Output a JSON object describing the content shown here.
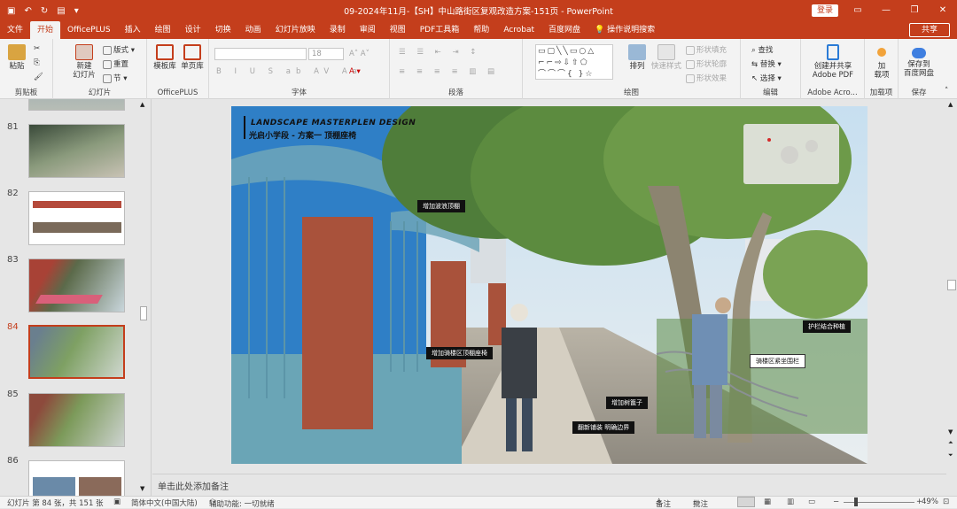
{
  "window": {
    "title": "09-2024年11月-【SH】中山路街区复观改造方案-151页 - PowerPoint",
    "login": "登录"
  },
  "tabs": [
    "文件",
    "开始",
    "OfficePLUS",
    "插入",
    "绘图",
    "设计",
    "切换",
    "动画",
    "幻灯片放映",
    "录制",
    "审阅",
    "视图",
    "PDF工具箱",
    "帮助",
    "Acrobat",
    "百度网盘"
  ],
  "active_tab": "开始",
  "tell_me": "操作说明搜索",
  "share": "共享",
  "ribbon": {
    "clipboard": {
      "paste": "粘贴",
      "label": "剪贴板"
    },
    "slides": {
      "new": "新建\n幻灯片",
      "layout": "版式",
      "reset": "重置",
      "section": "节",
      "label": "幻灯片"
    },
    "officeplus": {
      "templates": "模板库",
      "single": "单页库",
      "label": "OfficePLUS"
    },
    "font": {
      "size": "18",
      "label": "字体"
    },
    "paragraph": {
      "label": "段落"
    },
    "drawing": {
      "arrange": "排列",
      "quick_styles": "快速样式",
      "fill": "形状填充",
      "outline": "形状轮廓",
      "effects": "形状效果",
      "label": "绘图"
    },
    "editing": {
      "find": "查找",
      "replace": "替换",
      "select": "选择",
      "label": "编辑"
    },
    "adobe": {
      "create": "创建并共享\nAdobe PDF",
      "label": "Adobe Acro..."
    },
    "addins": {
      "add": "加\n载项",
      "label": "加载项"
    },
    "save": {
      "save": "保存到\n百度网盘",
      "label": "保存"
    }
  },
  "thumbnails": [
    {
      "num": "81"
    },
    {
      "num": "82"
    },
    {
      "num": "83"
    },
    {
      "num": "84",
      "selected": true
    },
    {
      "num": "85"
    },
    {
      "num": "86"
    }
  ],
  "slide": {
    "title_en": "LANDSCAPE MASTERPLEN DESIGN",
    "title_cn": "光启小学段 - 方案一  顶棚座椅",
    "callouts": [
      "增加波浪顶棚",
      "增加骑楼区顶棚座椅",
      "护栏结合种植",
      "骑楼区紧坐围栏",
      "增加树篦子",
      "翻新铺装 明确边界"
    ]
  },
  "notes_placeholder": "单击此处添加备注",
  "status": {
    "slide_info": "幻灯片 第 84 张，共 151 张",
    "language": "简体中文(中国大陆)",
    "accessibility": "辅助功能: 一切就绪",
    "notes": "备注",
    "comments": "批注",
    "zoom": "49%"
  },
  "colors": {
    "accent": "#c43e1c"
  }
}
